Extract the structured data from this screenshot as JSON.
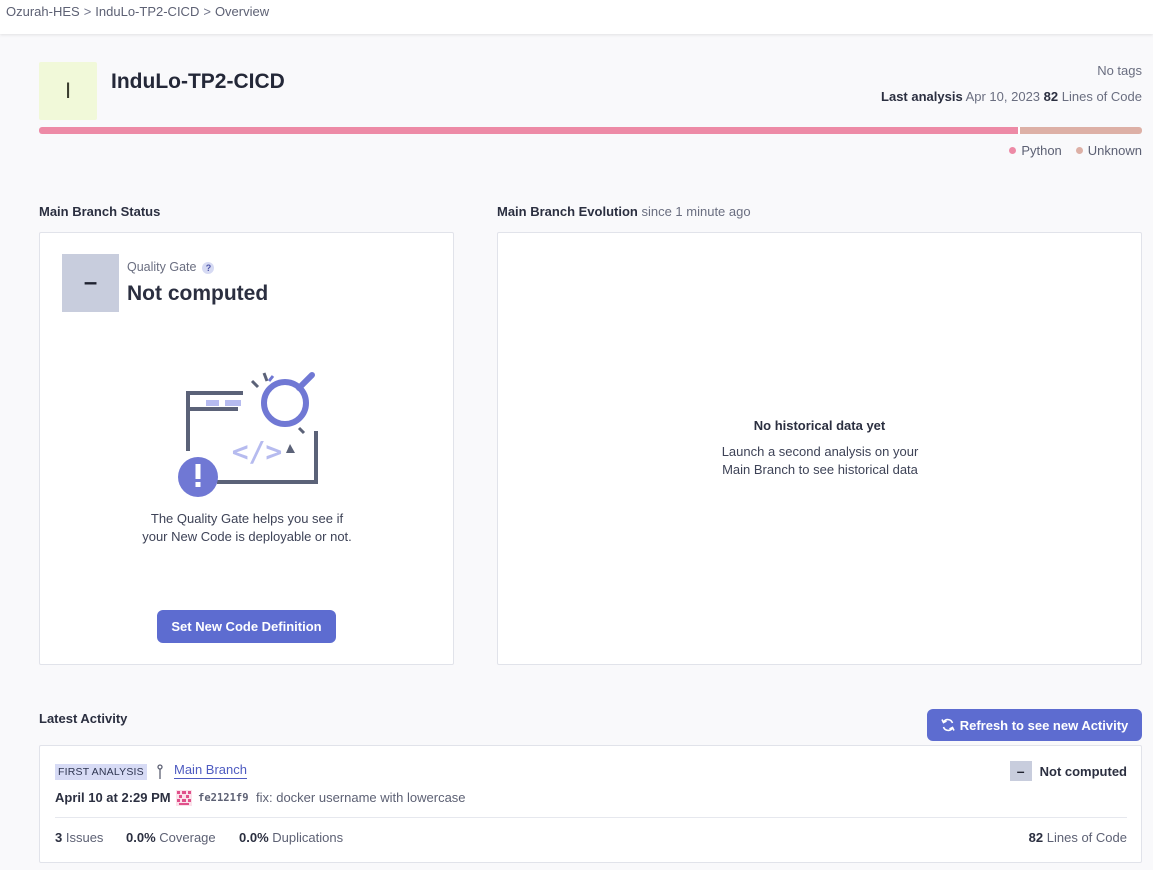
{
  "breadcrumb": {
    "org": "Ozurah-HES",
    "project": "InduLo-TP2-CICD",
    "page": "Overview",
    "separator": ">"
  },
  "project": {
    "avatar_letter": "I",
    "name": "InduLo-TP2-CICD",
    "tags": "No tags",
    "last_analysis_label": "Last analysis",
    "last_analysis_date": "Apr 10, 2023",
    "loc_count": "82",
    "loc_label": "Lines of Code"
  },
  "languages": [
    {
      "name": "Python",
      "fraction": 0.889,
      "color": "#ed8aa6"
    },
    {
      "name": "Unknown",
      "fraction": 0.111,
      "color": "#ddb0a6"
    }
  ],
  "status": {
    "section_title": "Main Branch Status",
    "gate_label": "Quality Gate",
    "gate_help": "?",
    "gate_symbol": "–",
    "gate_status": "Not computed",
    "description": "The Quality Gate helps you see if your New Code is deployable or not.",
    "button_label": "Set New Code Definition"
  },
  "evolution": {
    "section_title": "Main Branch Evolution",
    "since": "since 1 minute ago",
    "empty_title": "No historical data yet",
    "empty_text": "Launch a second analysis on your Main Branch to see historical data"
  },
  "activity": {
    "section_title": "Latest Activity",
    "refresh_label": "Refresh to see new Activity",
    "badge": "FIRST ANALYSIS",
    "branch": "Main Branch",
    "gate_symbol": "–",
    "gate_status": "Not computed",
    "date": "April 10 at 2:29 PM",
    "commit_hash": "fe2121f9",
    "commit_message": "fix: docker username with lowercase",
    "issues_value": "3",
    "issues_label": "Issues",
    "coverage_value": "0.0%",
    "coverage_label": "Coverage",
    "duplications_value": "0.0%",
    "duplications_label": "Duplications",
    "loc_value": "82",
    "loc_label": "Lines of Code"
  },
  "icons": [
    "help-icon",
    "quality-gate-illustration",
    "branch-icon",
    "commit-avatar-icon",
    "refresh-icon"
  ]
}
